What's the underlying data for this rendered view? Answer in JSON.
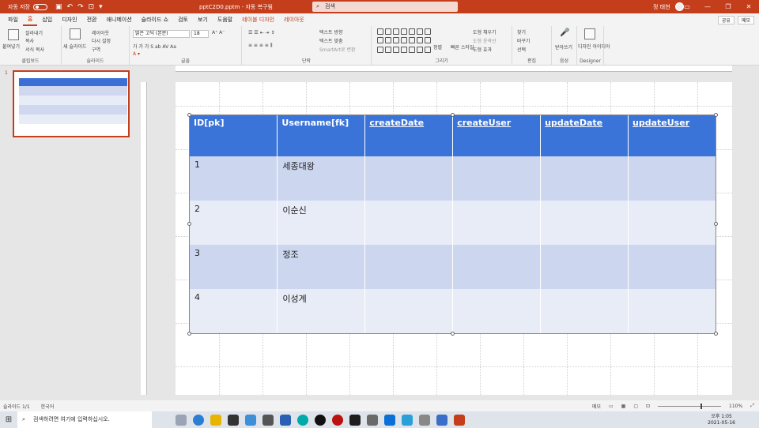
{
  "titlebar": {
    "autosave_label": "자동 저장",
    "autosave_state": "끔",
    "doc_title": "pptC2D0.pptm  -  자동 복구됨",
    "search_placeholder": "검색",
    "user_name": "정 태현"
  },
  "tabs": [
    {
      "label": "파일"
    },
    {
      "label": "홈"
    },
    {
      "label": "삽입"
    },
    {
      "label": "디자인"
    },
    {
      "label": "전환"
    },
    {
      "label": "애니메이션"
    },
    {
      "label": "슬라이드 쇼"
    },
    {
      "label": "검토"
    },
    {
      "label": "보기"
    },
    {
      "label": "도움말"
    },
    {
      "label": "테이블 디자인"
    },
    {
      "label": "레이아웃"
    }
  ],
  "tab_share": "공유",
  "tab_memo": "메모",
  "ribbon": {
    "clipboard": {
      "paste": "붙여넣기",
      "cut": "잘라내기",
      "copy": "복사",
      "format": "서식 복사",
      "name": "클립보드"
    },
    "slides": {
      "new": "새 슬라이드",
      "layout": "레이아웃",
      "reset": "다시 설정",
      "section": "구역",
      "name": "슬라이드"
    },
    "font": {
      "family": "맑은 고딕 (본문)",
      "size": "18",
      "name": "글꼴"
    },
    "paragraph": {
      "text_dir": "텍스트 방향",
      "align": "텍스트 맞춤",
      "smartart": "SmartArt로 변환",
      "name": "단락"
    },
    "drawing": {
      "arrange": "정렬",
      "quick": "빠른 스타일",
      "fill": "도형 채우기",
      "outline": "도형 윤곽선",
      "effect": "도형 효과",
      "name": "그리기"
    },
    "editing": {
      "find": "찾기",
      "replace": "바꾸기",
      "select": "선택",
      "name": "편집"
    },
    "voice": {
      "dictate": "받아쓰기",
      "name": "음성"
    },
    "designer": {
      "ideas": "디자인 아이디어",
      "name": "Designer"
    }
  },
  "thumbnail": {
    "number": "1"
  },
  "table": {
    "headers": [
      "ID[pk]",
      "Username[fk]",
      "createDate",
      "createUser",
      "updateDate",
      "updateUser"
    ],
    "rows": [
      [
        "1",
        "세종대왕",
        "",
        "",
        "",
        ""
      ],
      [
        "2",
        "이순신",
        "",
        "",
        "",
        ""
      ],
      [
        "3",
        "정조",
        "",
        "",
        "",
        ""
      ],
      [
        "4",
        "이성계",
        "",
        "",
        "",
        ""
      ]
    ]
  },
  "statusbar": {
    "slide_info": "슬라이드 1/1",
    "language": "한국어",
    "notes": "메모",
    "zoom": "110%"
  },
  "taskbar": {
    "search_placeholder": "검색하려면 여기에 입력하십시오.",
    "time": "오후 1:05",
    "date": "2021-05-16"
  },
  "colors": {
    "accent": "#c43e1c",
    "table_header": "#3b74d8",
    "row_odd": "#ccd6ef",
    "row_even": "#e8ecf7"
  }
}
